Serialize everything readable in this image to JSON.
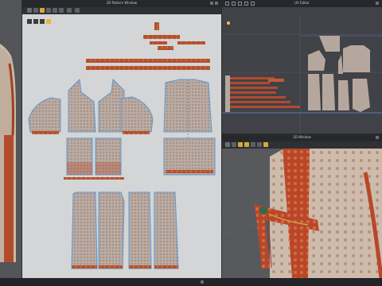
{
  "windows": {
    "pattern": {
      "title": "2D Pattern Window"
    },
    "uv": {
      "title": "UV Editor"
    },
    "view3d": {
      "title": "3D Window"
    }
  },
  "colors": {
    "canvas_2d": "#d4d5d7",
    "canvas_uv": "#404247",
    "canvas_3d": "#58595d",
    "piece_fabric": "#b9aca4",
    "piece_outline": "#5b9ad6",
    "trim": "#b8502f",
    "accent": "#f3c53a"
  },
  "icons": [
    "transform-pattern-icon",
    "edit-pattern-icon",
    "segment-tool-icon",
    "internal-line-icon",
    "select-mesh-icon",
    "fold-arrangement-icon",
    "zoom-icon",
    "camera-icon",
    "rotate-view-icon",
    "settings-icon"
  ]
}
